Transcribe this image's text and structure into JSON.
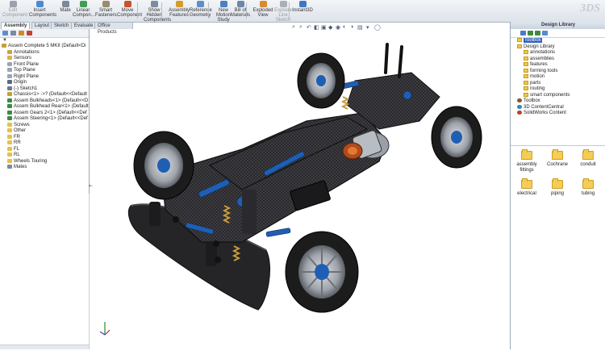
{
  "toolbar": {
    "buttons": [
      {
        "label": "Edit Component",
        "color": "#9aa3ad",
        "disabled": true
      },
      {
        "label": "Insert Components",
        "color": "#4a8bd6"
      },
      {
        "label": "Mate",
        "color": "#7a8a9c"
      },
      {
        "label": "Linear Compon...",
        "color": "#3f9e55"
      },
      {
        "label": "Smart Fasteners",
        "color": "#9a8c6a"
      },
      {
        "label": "Move Component",
        "color": "#c8522b"
      },
      {
        "label": "Show Hidden Components",
        "color": "#7b8ca3"
      },
      {
        "label": "Assembly Features",
        "color": "#d99a2b"
      },
      {
        "label": "Reference Geometry",
        "color": "#5d8fcc"
      },
      {
        "label": "New Motion Study",
        "color": "#4f7fc0"
      },
      {
        "label": "Bill of Materials",
        "color": "#6d87a8"
      },
      {
        "label": "Exploded View",
        "color": "#d98a2b"
      },
      {
        "label": "Explode Line Sketch",
        "color": "#a8b0ba",
        "disabled": true
      },
      {
        "label": "Instant3D",
        "color": "#3d78c9"
      }
    ]
  },
  "tabs": [
    "Assembly",
    "Layout",
    "Sketch",
    "Evaluate",
    "Office Products"
  ],
  "feature_tree": {
    "rows": [
      {
        "label": "Assem Complete 5 MKII (Default<Di",
        "indent": 0,
        "color": "#c8a030"
      },
      {
        "label": "Annotations",
        "indent": 1,
        "color": "#c9a24a"
      },
      {
        "label": "Sensors",
        "indent": 1,
        "color": "#e0b040"
      },
      {
        "label": "Front Plane",
        "indent": 1,
        "color": "#9aa6b4"
      },
      {
        "label": "Top Plane",
        "indent": 1,
        "color": "#9aa6b4"
      },
      {
        "label": "Right Plane",
        "indent": 1,
        "color": "#9aa6b4"
      },
      {
        "label": "Origin",
        "indent": 1,
        "color": "#5a6a80"
      },
      {
        "label": "(-) Sketch1",
        "indent": 1,
        "color": "#6a7a90"
      },
      {
        "label": "Chassis<1> ->? (Default<<Default",
        "indent": 1,
        "color": "#c8a030"
      },
      {
        "label": "Assem Bulkheads<1> (Default<<D",
        "indent": 1,
        "color": "#3e8a3e"
      },
      {
        "label": "Assem Bulkhead Rear<1> (Default",
        "indent": 1,
        "color": "#3e8a3e"
      },
      {
        "label": "Assem Gears 2<1> (Default<<Def",
        "indent": 1,
        "color": "#3e8a3e"
      },
      {
        "label": "Assem Steering<1> (Default<<Def",
        "indent": 1,
        "color": "#3e8a3e"
      },
      {
        "label": "Screws",
        "indent": 1,
        "color": "#e6c04a"
      },
      {
        "label": "Other",
        "indent": 1,
        "color": "#e6c04a"
      },
      {
        "label": "FR",
        "indent": 1,
        "color": "#e6c04a"
      },
      {
        "label": "RR",
        "indent": 1,
        "color": "#e6c04a"
      },
      {
        "label": "FL",
        "indent": 1,
        "color": "#e6c04a"
      },
      {
        "label": "RL",
        "indent": 1,
        "color": "#e6c04a"
      },
      {
        "label": "Wheels Touring",
        "indent": 1,
        "color": "#e6c04a"
      },
      {
        "label": "Mates",
        "indent": 1,
        "color": "#7a8aa0"
      }
    ]
  },
  "design_library": {
    "title": "Design Library",
    "tree": [
      {
        "label": "Toolbox",
        "indent": 0,
        "kind": "folder",
        "selected": true
      },
      {
        "label": "Design Library",
        "indent": 0,
        "kind": "folder"
      },
      {
        "label": "annotations",
        "indent": 1,
        "kind": "folder"
      },
      {
        "label": "assemblies",
        "indent": 1,
        "kind": "folder"
      },
      {
        "label": "features",
        "indent": 1,
        "kind": "folder"
      },
      {
        "label": "forming tools",
        "indent": 1,
        "kind": "folder"
      },
      {
        "label": "motion",
        "indent": 1,
        "kind": "folder"
      },
      {
        "label": "parts",
        "indent": 1,
        "kind": "folder"
      },
      {
        "label": "routing",
        "indent": 1,
        "kind": "folder"
      },
      {
        "label": "smart components",
        "indent": 1,
        "kind": "folder"
      },
      {
        "label": "Toolbox",
        "indent": 0,
        "kind": "globe"
      },
      {
        "label": "3D ContentCentral",
        "indent": 0,
        "kind": "globe"
      },
      {
        "label": "SolidWorks Content",
        "indent": 0,
        "kind": "globe"
      }
    ],
    "folders": [
      "assembly fittings",
      "Cochrane",
      "conduit",
      "electrical",
      "piping",
      "tubing"
    ]
  },
  "colors": {
    "accent": "#2f62b8",
    "chassis": "#2a2a2e",
    "anodized": "#1f5fb3",
    "tire": "#1c1c1c",
    "wheel": "#b8bcc2"
  }
}
